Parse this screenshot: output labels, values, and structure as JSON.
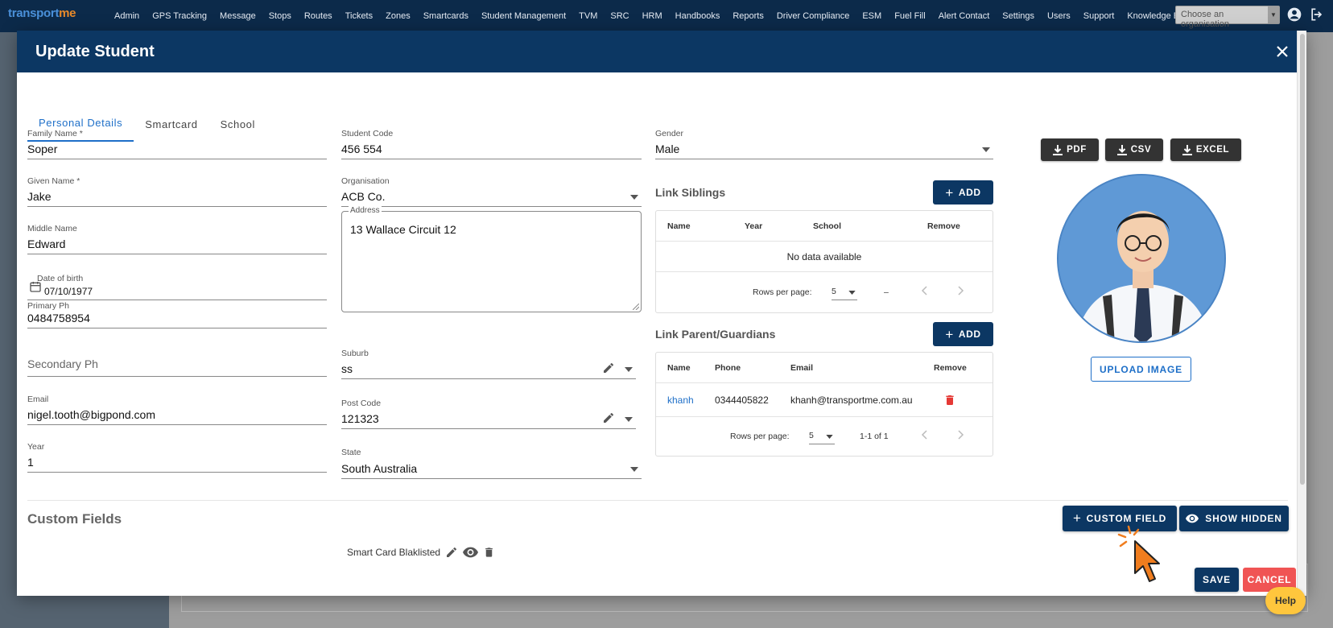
{
  "app": {
    "logo_part1": "transport",
    "logo_part2": "me",
    "nav": [
      "Admin",
      "GPS Tracking",
      "Message",
      "Stops",
      "Routes",
      "Tickets",
      "Zones",
      "Smartcards",
      "Student Management",
      "TVM",
      "SRC",
      "HRM",
      "Handbooks",
      "Reports",
      "Driver Compliance",
      "ESM",
      "Fuel Fill",
      "Alert Contact",
      "Settings",
      "Users",
      "Support",
      "Knowledge Base"
    ],
    "org_placeholder": "Choose an organisation"
  },
  "modal": {
    "title": "Update Student",
    "tabs": [
      "Personal Details",
      "Smartcard",
      "School"
    ]
  },
  "form": {
    "family_name": {
      "label": "Family Name *",
      "value": "Soper"
    },
    "given_name": {
      "label": "Given Name *",
      "value": "Jake"
    },
    "middle_name": {
      "label": "Middle Name",
      "value": "Edward"
    },
    "dob": {
      "label": "Date of birth",
      "value": "07/10/1977"
    },
    "primary_ph": {
      "label": "Primary Ph",
      "value": "0484758954"
    },
    "secondary_ph": {
      "placeholder": "Secondary Ph"
    },
    "email": {
      "label": "Email",
      "value": "nigel.tooth@bigpond.com"
    },
    "year": {
      "label": "Year",
      "value": "1"
    },
    "student_code": {
      "label": "Student Code",
      "value": "456 554"
    },
    "organisation": {
      "label": "Organisation",
      "value": "ACB Co."
    },
    "address": {
      "label": "Address",
      "value": "13 Wallace Circuit 12"
    },
    "suburb": {
      "label": "Suburb",
      "value": "ss"
    },
    "post_code": {
      "label": "Post Code",
      "value": "121323"
    },
    "state": {
      "label": "State",
      "value": "South Australia"
    },
    "gender": {
      "label": "Gender",
      "value": "Male"
    }
  },
  "siblings": {
    "title": "Link Siblings",
    "add_label": "ADD",
    "columns": [
      "Name",
      "Year",
      "School",
      "Remove"
    ],
    "empty_text": "No data available",
    "rows_per_page_label": "Rows per page:",
    "rows_per_page": "5",
    "range_text": "–"
  },
  "guardians": {
    "title": "Link Parent/Guardians",
    "add_label": "ADD",
    "columns": [
      "Name",
      "Phone",
      "Email",
      "Remove"
    ],
    "rows": [
      {
        "name": "khanh",
        "phone": "0344405822",
        "email": "khanh@transportme.com.au"
      }
    ],
    "rows_per_page_label": "Rows per page:",
    "rows_per_page": "5",
    "range_text": "1-1 of 1"
  },
  "exports": {
    "pdf": "PDF",
    "csv": "CSV",
    "excel": "EXCEL"
  },
  "upload_label": "UPLOAD IMAGE",
  "custom_fields": {
    "title": "Custom Fields",
    "add_label": "CUSTOM FIELD",
    "show_hidden_label": "SHOW HIDDEN",
    "items": [
      "Smart Card Blaklisted"
    ]
  },
  "actions": {
    "save": "SAVE",
    "cancel": "CANCEL"
  },
  "help_label": "Help",
  "colors": {
    "primary": "#0c3763",
    "accent": "#1e6fc8",
    "danger": "#f05454",
    "help": "#ffc63d"
  }
}
